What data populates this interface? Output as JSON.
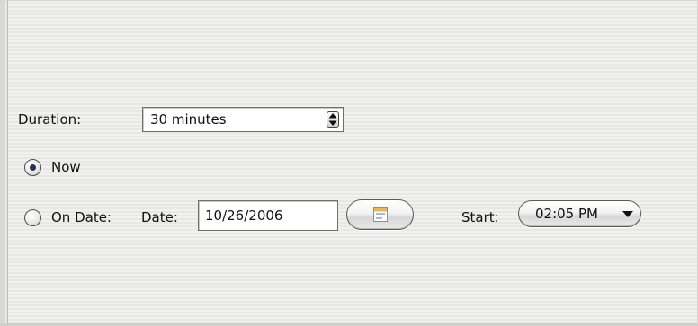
{
  "duration": {
    "label": "Duration:",
    "value": "30 minutes"
  },
  "schedule": {
    "now_label": "Now",
    "now_selected": true,
    "on_date_label": "On Date:",
    "on_date_selected": false
  },
  "date": {
    "label": "Date:",
    "value": "10/26/2006"
  },
  "start": {
    "label": "Start:",
    "value": "02:05 PM"
  },
  "icons": {
    "duration_spinner": "spinner-updown-icon",
    "calendar": "calendar-icon",
    "dropdown": "dropdown-arrow-icon"
  },
  "colors": {
    "radio_selected_dot": "#23324f",
    "panel_background": "#f1f1ef"
  }
}
